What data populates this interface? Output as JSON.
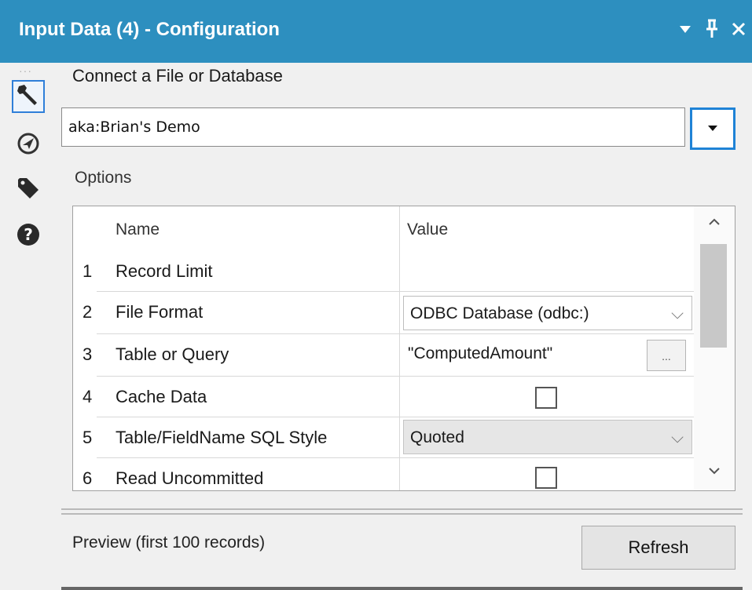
{
  "window": {
    "title": "Input Data (4) - Configuration",
    "controls": [
      "dropdown-arrow-icon",
      "pin-icon",
      "close-icon"
    ],
    "accent_color": "#2d8fbf"
  },
  "toolbar": {
    "items": [
      {
        "icon": "wrench-icon",
        "active": true
      },
      {
        "icon": "navigate-icon",
        "active": false
      },
      {
        "icon": "tag-icon",
        "active": false
      },
      {
        "icon": "help-icon",
        "active": false
      }
    ]
  },
  "connect": {
    "label": "Connect a File or Database",
    "value": "aka:Brian's Demo"
  },
  "options": {
    "label": "Options",
    "columns": [
      "Name",
      "Value"
    ],
    "rows": [
      {
        "num": "1",
        "name": "Record Limit",
        "value": ""
      },
      {
        "num": "2",
        "name": "File Format",
        "value": "ODBC Database (odbc:)"
      },
      {
        "num": "3",
        "name": "Table or Query",
        "value": "\"ComputedAmount\"",
        "button": "..."
      },
      {
        "num": "4",
        "name": "Cache Data",
        "checked": false
      },
      {
        "num": "5",
        "name": "Table/FieldName SQL Style",
        "value": "Quoted"
      },
      {
        "num": "6",
        "name": "Read Uncommitted",
        "checked": false
      }
    ]
  },
  "preview": {
    "label": "Preview (first 100 records)",
    "refresh_label": "Refresh"
  }
}
